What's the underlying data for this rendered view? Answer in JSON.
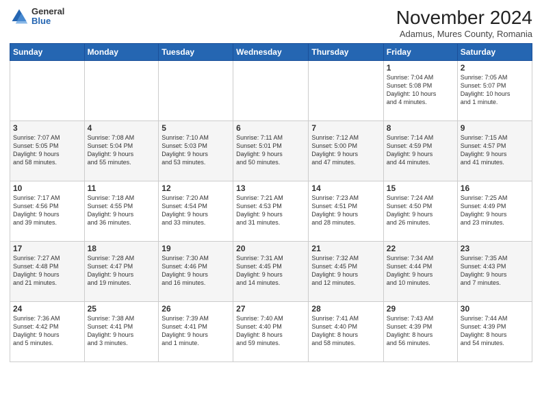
{
  "header": {
    "logo": {
      "general": "General",
      "blue": "Blue"
    },
    "title": "November 2024",
    "subtitle": "Adamus, Mures County, Romania"
  },
  "columns": [
    "Sunday",
    "Monday",
    "Tuesday",
    "Wednesday",
    "Thursday",
    "Friday",
    "Saturday"
  ],
  "weeks": [
    [
      {
        "day": "",
        "info": ""
      },
      {
        "day": "",
        "info": ""
      },
      {
        "day": "",
        "info": ""
      },
      {
        "day": "",
        "info": ""
      },
      {
        "day": "",
        "info": ""
      },
      {
        "day": "1",
        "info": "Sunrise: 7:04 AM\nSunset: 5:08 PM\nDaylight: 10 hours\nand 4 minutes."
      },
      {
        "day": "2",
        "info": "Sunrise: 7:05 AM\nSunset: 5:07 PM\nDaylight: 10 hours\nand 1 minute."
      }
    ],
    [
      {
        "day": "3",
        "info": "Sunrise: 7:07 AM\nSunset: 5:05 PM\nDaylight: 9 hours\nand 58 minutes."
      },
      {
        "day": "4",
        "info": "Sunrise: 7:08 AM\nSunset: 5:04 PM\nDaylight: 9 hours\nand 55 minutes."
      },
      {
        "day": "5",
        "info": "Sunrise: 7:10 AM\nSunset: 5:03 PM\nDaylight: 9 hours\nand 53 minutes."
      },
      {
        "day": "6",
        "info": "Sunrise: 7:11 AM\nSunset: 5:01 PM\nDaylight: 9 hours\nand 50 minutes."
      },
      {
        "day": "7",
        "info": "Sunrise: 7:12 AM\nSunset: 5:00 PM\nDaylight: 9 hours\nand 47 minutes."
      },
      {
        "day": "8",
        "info": "Sunrise: 7:14 AM\nSunset: 4:59 PM\nDaylight: 9 hours\nand 44 minutes."
      },
      {
        "day": "9",
        "info": "Sunrise: 7:15 AM\nSunset: 4:57 PM\nDaylight: 9 hours\nand 41 minutes."
      }
    ],
    [
      {
        "day": "10",
        "info": "Sunrise: 7:17 AM\nSunset: 4:56 PM\nDaylight: 9 hours\nand 39 minutes."
      },
      {
        "day": "11",
        "info": "Sunrise: 7:18 AM\nSunset: 4:55 PM\nDaylight: 9 hours\nand 36 minutes."
      },
      {
        "day": "12",
        "info": "Sunrise: 7:20 AM\nSunset: 4:54 PM\nDaylight: 9 hours\nand 33 minutes."
      },
      {
        "day": "13",
        "info": "Sunrise: 7:21 AM\nSunset: 4:53 PM\nDaylight: 9 hours\nand 31 minutes."
      },
      {
        "day": "14",
        "info": "Sunrise: 7:23 AM\nSunset: 4:51 PM\nDaylight: 9 hours\nand 28 minutes."
      },
      {
        "day": "15",
        "info": "Sunrise: 7:24 AM\nSunset: 4:50 PM\nDaylight: 9 hours\nand 26 minutes."
      },
      {
        "day": "16",
        "info": "Sunrise: 7:25 AM\nSunset: 4:49 PM\nDaylight: 9 hours\nand 23 minutes."
      }
    ],
    [
      {
        "day": "17",
        "info": "Sunrise: 7:27 AM\nSunset: 4:48 PM\nDaylight: 9 hours\nand 21 minutes."
      },
      {
        "day": "18",
        "info": "Sunrise: 7:28 AM\nSunset: 4:47 PM\nDaylight: 9 hours\nand 19 minutes."
      },
      {
        "day": "19",
        "info": "Sunrise: 7:30 AM\nSunset: 4:46 PM\nDaylight: 9 hours\nand 16 minutes."
      },
      {
        "day": "20",
        "info": "Sunrise: 7:31 AM\nSunset: 4:45 PM\nDaylight: 9 hours\nand 14 minutes."
      },
      {
        "day": "21",
        "info": "Sunrise: 7:32 AM\nSunset: 4:45 PM\nDaylight: 9 hours\nand 12 minutes."
      },
      {
        "day": "22",
        "info": "Sunrise: 7:34 AM\nSunset: 4:44 PM\nDaylight: 9 hours\nand 10 minutes."
      },
      {
        "day": "23",
        "info": "Sunrise: 7:35 AM\nSunset: 4:43 PM\nDaylight: 9 hours\nand 7 minutes."
      }
    ],
    [
      {
        "day": "24",
        "info": "Sunrise: 7:36 AM\nSunset: 4:42 PM\nDaylight: 9 hours\nand 5 minutes."
      },
      {
        "day": "25",
        "info": "Sunrise: 7:38 AM\nSunset: 4:41 PM\nDaylight: 9 hours\nand 3 minutes."
      },
      {
        "day": "26",
        "info": "Sunrise: 7:39 AM\nSunset: 4:41 PM\nDaylight: 9 hours\nand 1 minute."
      },
      {
        "day": "27",
        "info": "Sunrise: 7:40 AM\nSunset: 4:40 PM\nDaylight: 8 hours\nand 59 minutes."
      },
      {
        "day": "28",
        "info": "Sunrise: 7:41 AM\nSunset: 4:40 PM\nDaylight: 8 hours\nand 58 minutes."
      },
      {
        "day": "29",
        "info": "Sunrise: 7:43 AM\nSunset: 4:39 PM\nDaylight: 8 hours\nand 56 minutes."
      },
      {
        "day": "30",
        "info": "Sunrise: 7:44 AM\nSunset: 4:39 PM\nDaylight: 8 hours\nand 54 minutes."
      }
    ]
  ]
}
